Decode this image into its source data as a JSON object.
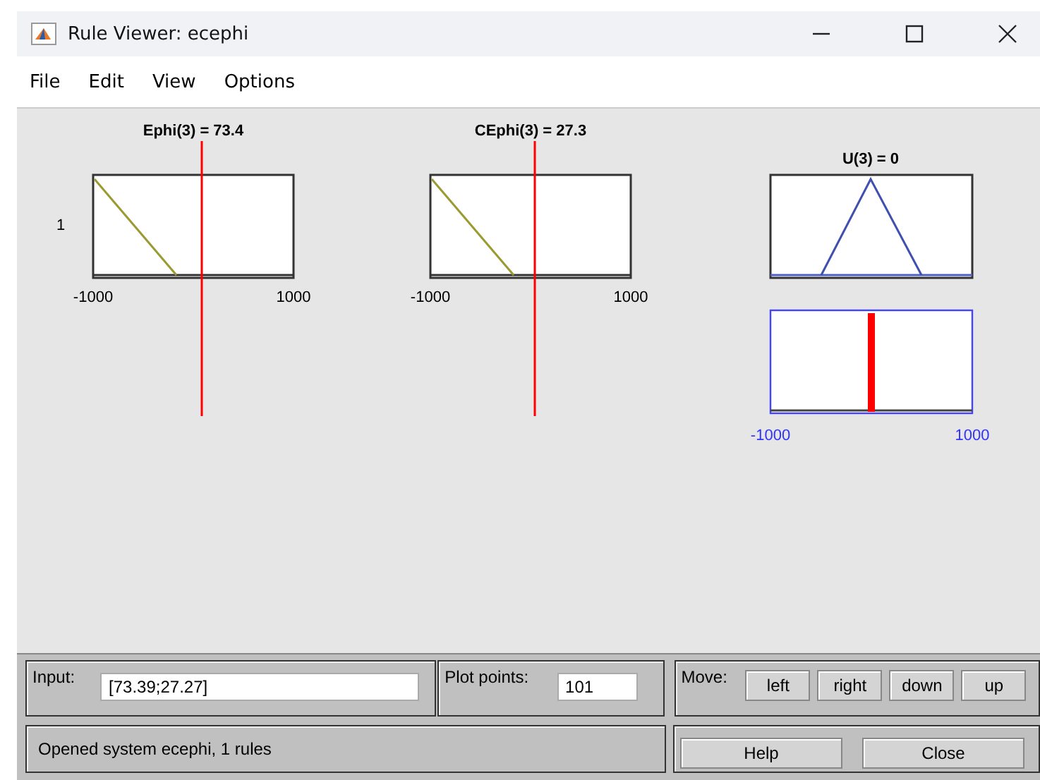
{
  "window": {
    "title": "Rule Viewer: ecephi"
  },
  "menu": [
    "File",
    "Edit",
    "View",
    "Options"
  ],
  "inputs": [
    {
      "title": "Ephi(3) = 73.4",
      "ylabel": "1",
      "xmin": "-1000",
      "xmax": "1000"
    },
    {
      "title": "CEphi(3) = 27.3",
      "xmin": "-1000",
      "xmax": "1000"
    }
  ],
  "output": {
    "title": "U(3) = 0",
    "xmin": "-1000",
    "xmax": "1000"
  },
  "input_field": {
    "label": "Input:",
    "value": "[73.39;27.27]"
  },
  "plot_points": {
    "label": "Plot points:",
    "value": "101"
  },
  "move": {
    "label": "Move:",
    "buttons": [
      "left",
      "right",
      "down",
      "up"
    ]
  },
  "status": "Opened system ecephi, 1 rules",
  "buttons": [
    "Help",
    "Close"
  ]
}
